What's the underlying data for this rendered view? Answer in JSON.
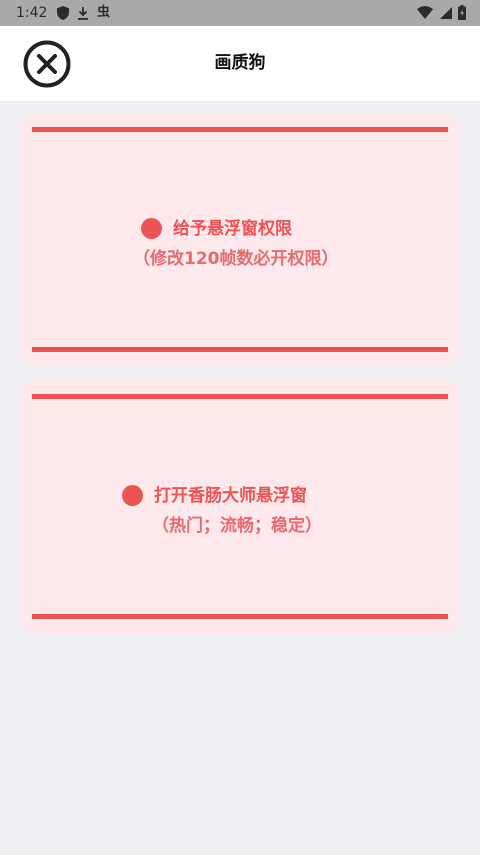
{
  "status_bar": {
    "time": "1:42",
    "left_icons": [
      "shield-icon",
      "download-icon",
      "bug-icon"
    ],
    "bug_glyph": "虫",
    "right_icons": [
      "wifi-icon",
      "cell-signal-icon",
      "battery-icon"
    ]
  },
  "header": {
    "title": "画质狗",
    "close_icon": "close-circle-icon"
  },
  "cards": [
    {
      "title": "给予悬浮窗权限",
      "subtitle": "（修改120帧数必开权限）"
    },
    {
      "title": "打开香肠大师悬浮窗",
      "subtitle": "（热门；流畅；稳定）"
    }
  ],
  "colors": {
    "accent": "#ee5354",
    "card_background": "#fde9ec",
    "page_background": "#eeedf2",
    "status_bar": "#a9a9a9"
  }
}
